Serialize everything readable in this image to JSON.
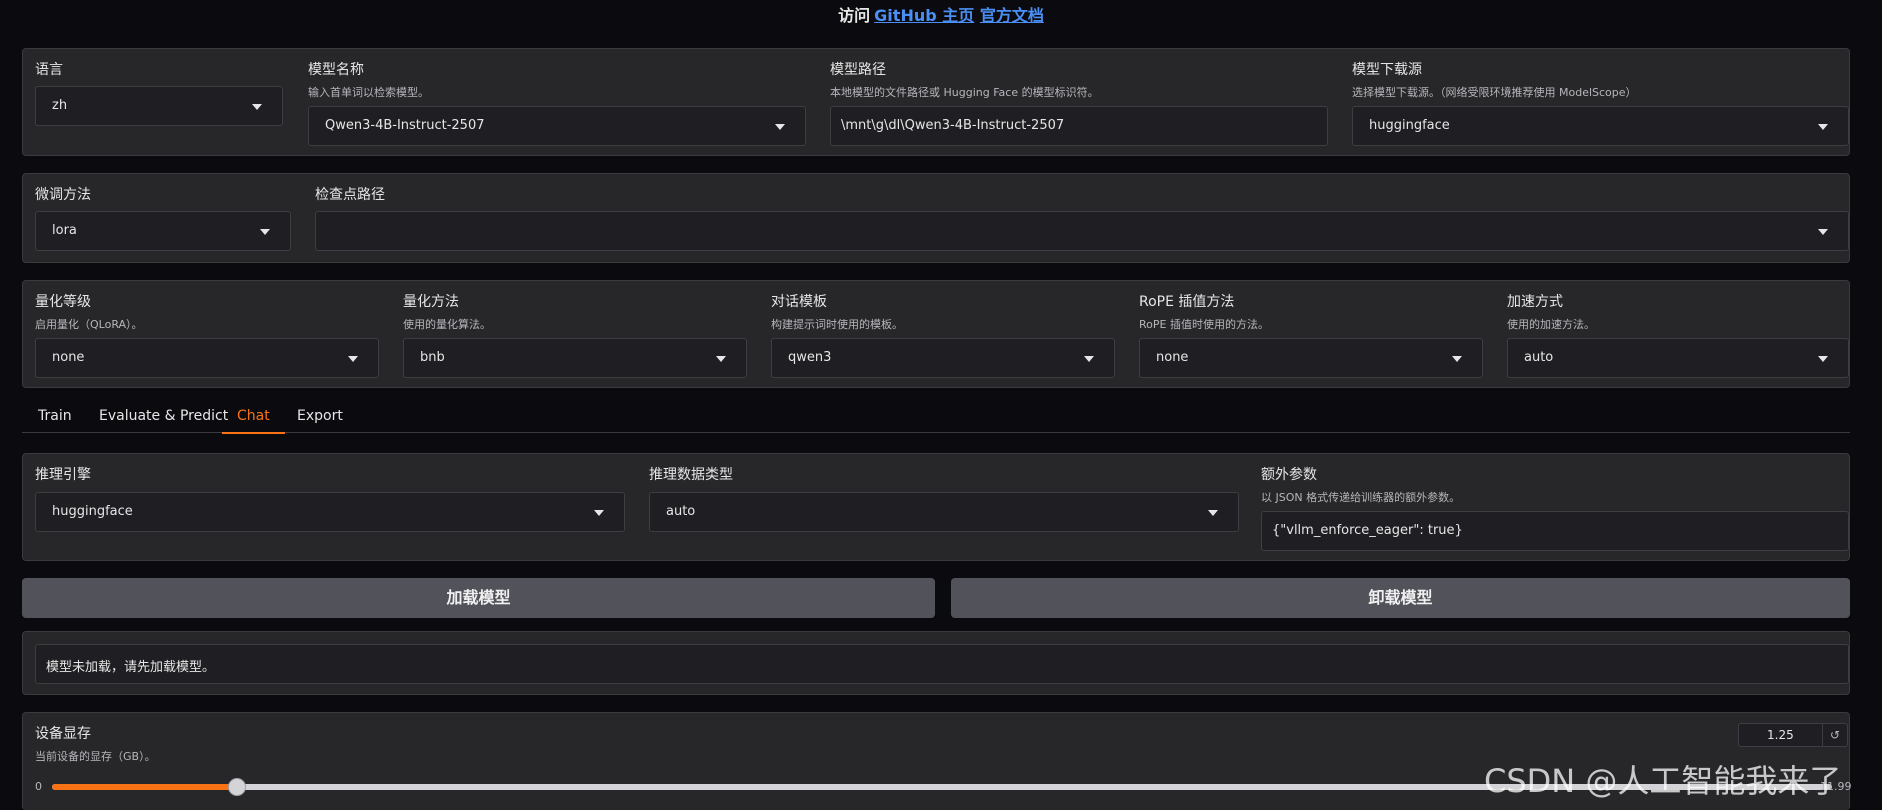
{
  "header": {
    "prefix": "访问",
    "github": "GitHub 主页",
    "docs": "官方文档"
  },
  "model_row": {
    "lang": {
      "label": "语言",
      "value": "zh"
    },
    "model_name": {
      "label": "模型名称",
      "info": "输入首单词以检索模型。",
      "value": "Qwen3-4B-Instruct-2507"
    },
    "model_path": {
      "label": "模型路径",
      "info": "本地模型的文件路径或 Hugging Face 的模型标识符。",
      "value": "\\mnt\\g\\dl\\Qwen3-4B-Instruct-2507"
    },
    "hub": {
      "label": "模型下载源",
      "info": "选择模型下载源。（网络受限环境推荐使用 ModelScope）",
      "value": "huggingface"
    }
  },
  "finetune_row": {
    "method": {
      "label": "微调方法",
      "value": "lora"
    },
    "checkpoint": {
      "label": "检查点路径",
      "value": ""
    }
  },
  "quant_row": {
    "quant_bit": {
      "label": "量化等级",
      "info": "启用量化（QLoRA）。",
      "value": "none"
    },
    "quant_method": {
      "label": "量化方法",
      "info": "使用的量化算法。",
      "value": "bnb"
    },
    "template": {
      "label": "对话模板",
      "info": "构建提示词时使用的模板。",
      "value": "qwen3"
    },
    "rope": {
      "label": "RoPE 插值方法",
      "info": "RoPE 插值时使用的方法。",
      "value": "none"
    },
    "booster": {
      "label": "加速方式",
      "info": "使用的加速方法。",
      "value": "auto"
    }
  },
  "tabs": [
    "Train",
    "Evaluate & Predict",
    "Chat",
    "Export"
  ],
  "active_tab": "Chat",
  "chat": {
    "infer_backend": {
      "label": "推理引擎",
      "value": "huggingface"
    },
    "infer_dtype": {
      "label": "推理数据类型",
      "value": "auto"
    },
    "extra_args": {
      "label": "额外参数",
      "info": "以 JSON 格式传递给训练器的额外参数。",
      "value": "{\"vllm_enforce_eager\": true}"
    },
    "load_btn": "加载模型",
    "unload_btn": "卸载模型",
    "status": "模型未加载，请先加载模型。",
    "vram": {
      "label": "设备显存",
      "info": "当前设备的显存（GB）。",
      "value": "1.25",
      "min": "0",
      "max": "11.99",
      "fraction": 0.104
    }
  },
  "watermark": "CSDN @人工智能我来了",
  "colors": {
    "accent": "#f97316",
    "link": "#4a8ff5",
    "panel": "#27272a",
    "button": "#52525b"
  },
  "icons": {
    "reset": "↺"
  }
}
